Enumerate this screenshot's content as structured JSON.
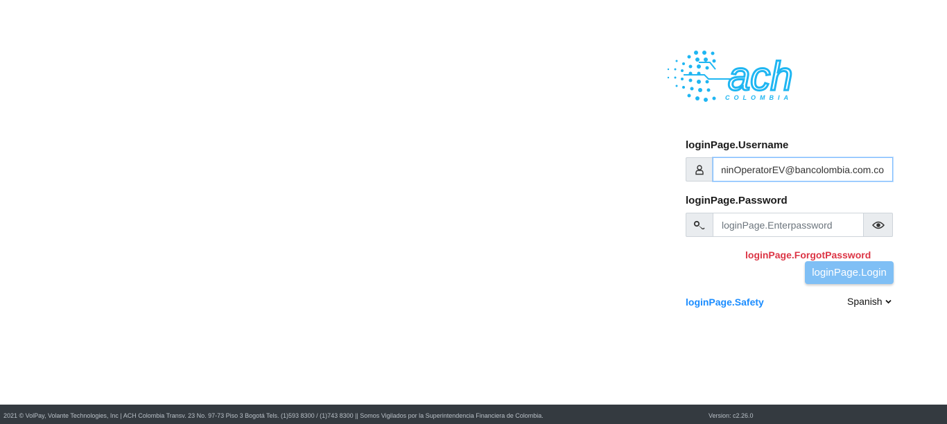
{
  "brand": {
    "logo_text": "ach",
    "logo_subtitle": "COLOMBIA",
    "accent_color": "#1fb6f2"
  },
  "login": {
    "username_label": "loginPage.Username",
    "username_value": "AdminOperatorEV@bancolombia.com.co",
    "username_icon": "user-icon",
    "password_label": "loginPage.Password",
    "password_placeholder": "loginPage.Enterpassword",
    "password_icon": "key-icon",
    "show_password_icon": "eye-icon",
    "forgot_password": "loginPage.ForgotPassword",
    "login_button": "loginPage.Login",
    "safety_link": "loginPage.Safety",
    "language": "Spanish"
  },
  "footer": {
    "copyright": "2021 © VolPay, Volante Technologies, Inc | ACH Colombia Transv. 23 No. 97-73 Piso 3 Bogotá Tels. (1)593 8300 / (1)743 8300 || Somos Vigilados por la Superintendencia Financiera de Colombia.",
    "version": "Version: c2.26.0"
  }
}
